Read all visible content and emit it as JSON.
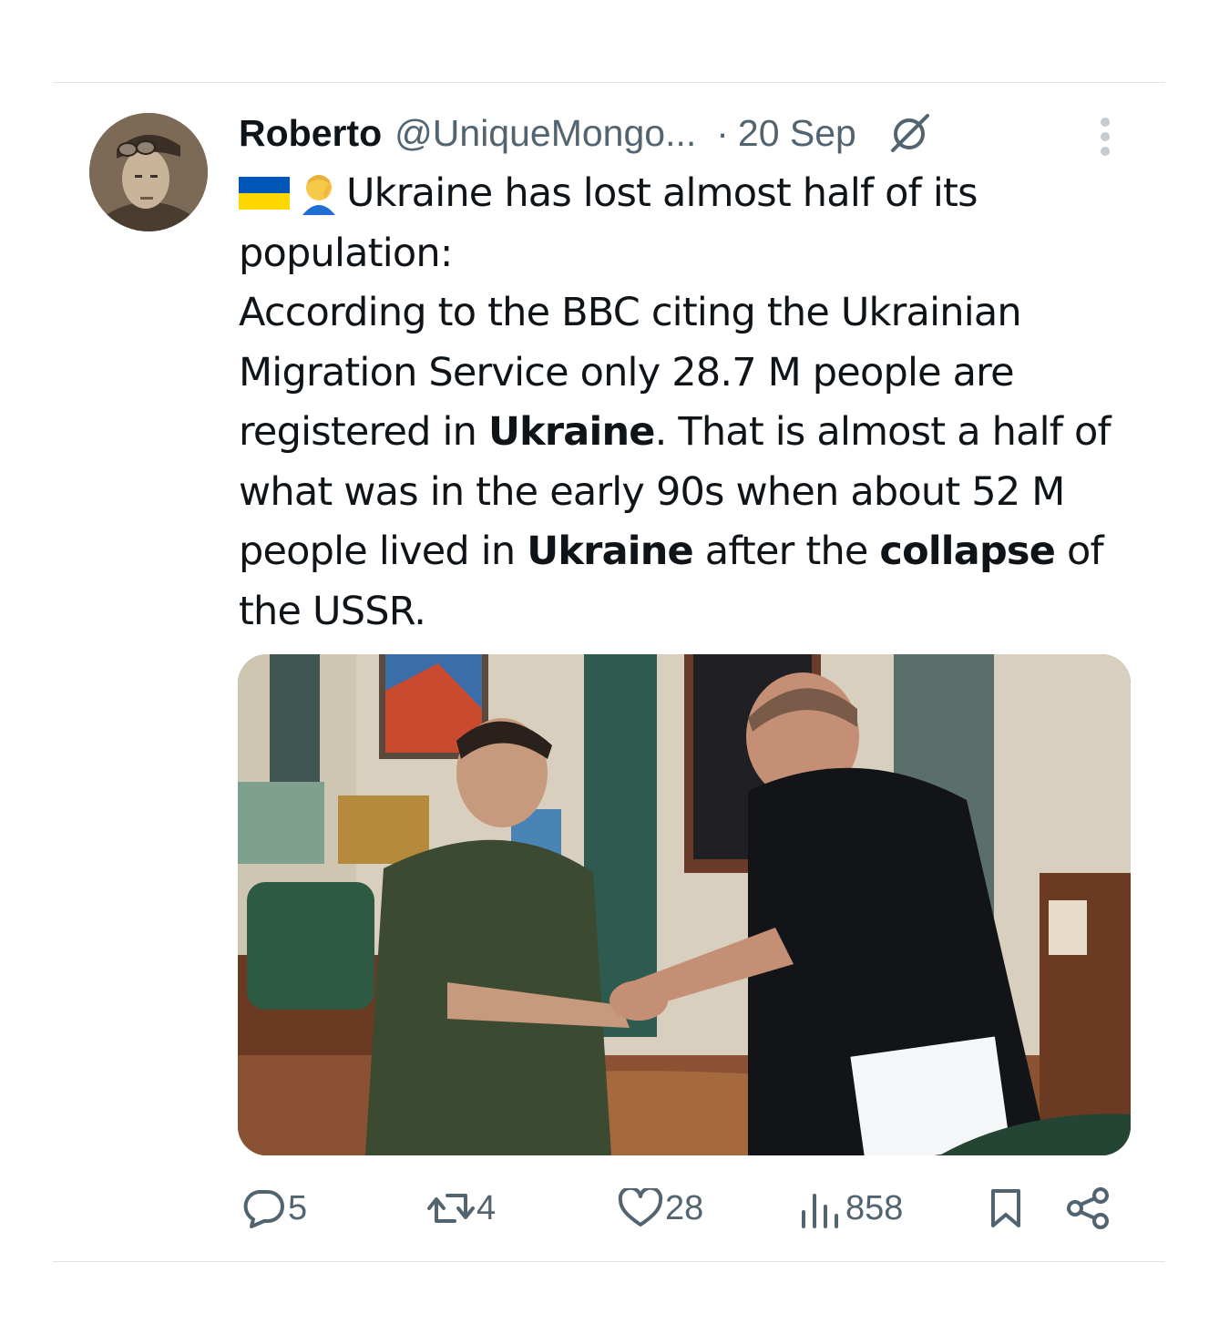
{
  "tweet": {
    "author_name": "Roberto",
    "author_handle": "@UniqueMongo...",
    "separator": "·",
    "date": "20 Sep",
    "text_segments": [
      "Ukraine has lost almost half of its population:",
      "According to the BBC citing the Ukrainian Migration Service only 28.7 M people are registered in ",
      "Ukraine",
      ". That is almost a half of what was in the early 90s when about 52 M people lived in ",
      "Ukraine",
      " after the ",
      "collapse",
      " of the USSR."
    ],
    "emoji": [
      "ukraine-flag",
      "facepalm"
    ],
    "icons": {
      "more": "more-vertical-icon",
      "not-interested": "slash-circle-icon"
    }
  },
  "actions": {
    "reply_count": "5",
    "retweet_count": "4",
    "like_count": "28",
    "view_count": "858"
  },
  "colors": {
    "text": "#0f1419",
    "secondary": "#536471",
    "divider": "#e1e4e7",
    "flag_blue": "#0057b7",
    "flag_yellow": "#ffd700"
  }
}
